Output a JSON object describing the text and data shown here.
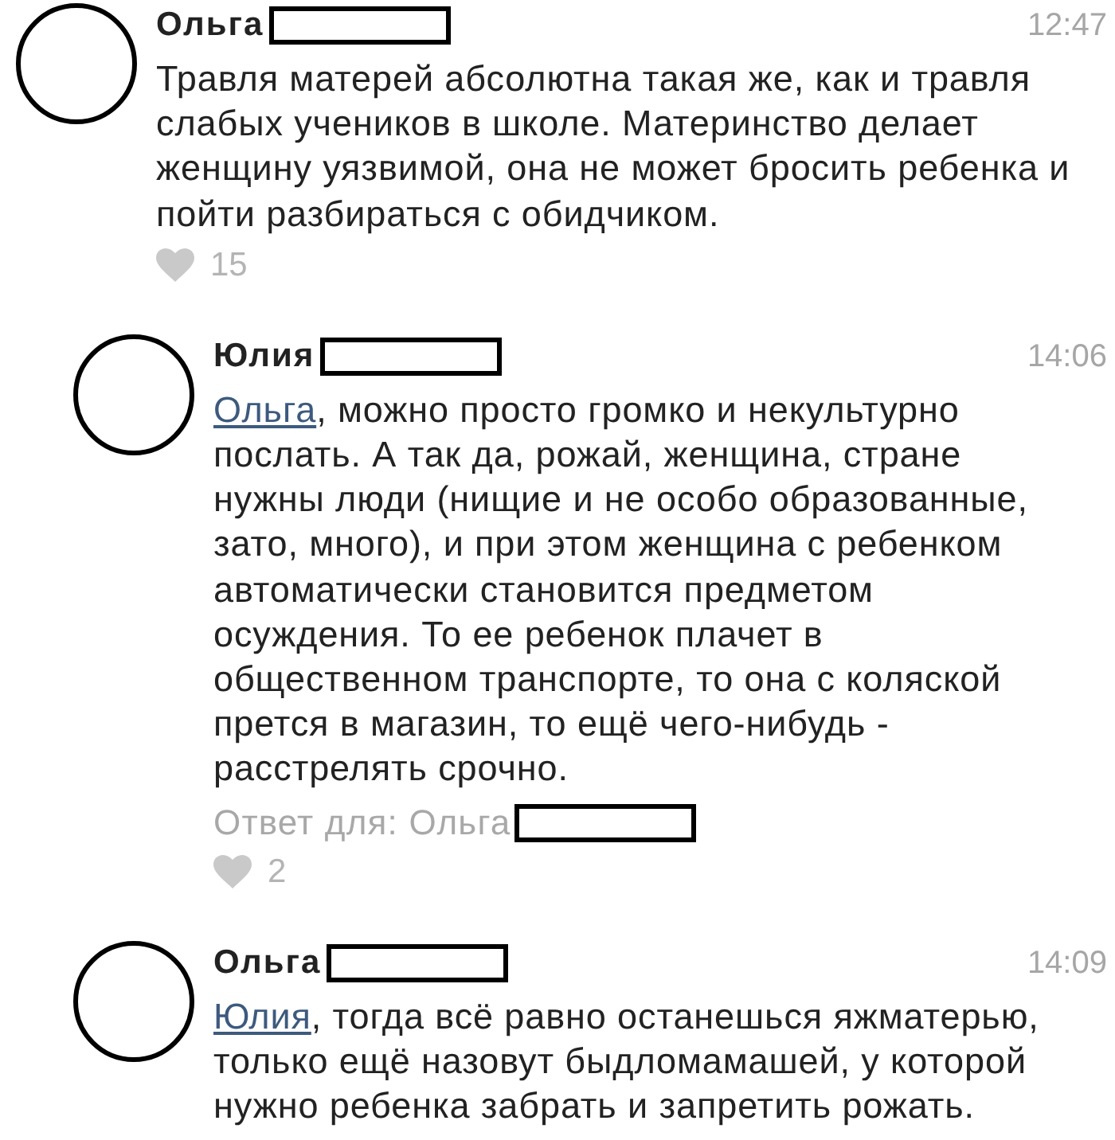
{
  "comments": [
    {
      "author": "Ольга",
      "surname_redacted": true,
      "time": "12:47",
      "text": "Травля матерей абсолютна такая же, как и травля слабых учеников в школе. Материнство делает женщину уязвимой, она не может бросить ребенка и пойти разбираться с обидчиком.",
      "likes": "15",
      "children": [
        {
          "author": "Юлия",
          "surname_redacted": true,
          "time": "14:06",
          "mention": "Ольга",
          "text": ", можно просто громко и некультурно послать. А так да, рожай, женщина, стране нужны люди (нищие и не особо образованные, зато, много), и при этом женщина с ребенком автоматически становится предметом осуждения. То ее ребенок плачет в общественном транспорте, то она с коляской прется в магазин, то ещё чего-нибудь - расстрелять срочно.",
          "reply_to": {
            "text": "Ответ для: Ольга",
            "surname_redacted": true
          },
          "likes": "2"
        },
        {
          "author": "Ольга",
          "surname_redacted": true,
          "time": "14:09",
          "mention": "Юлия",
          "text": ", тогда всё равно останешься яжматерью, только ещё назовут быдломамашей, у которой нужно ребенка забрать и запретить рожать."
        }
      ]
    }
  ]
}
